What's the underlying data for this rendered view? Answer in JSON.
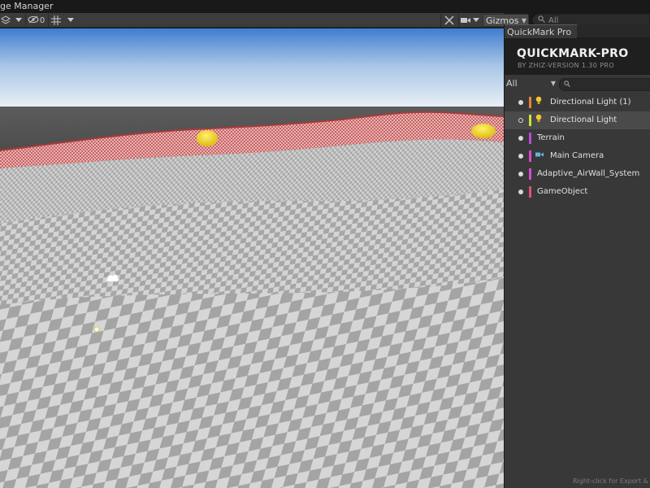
{
  "menu": {
    "title": "ge Manager"
  },
  "scene_toolbar": {
    "layers_icon": "layers-icon",
    "visibility_count": "0",
    "grid_icon": "grid-icon",
    "tools_icon": "tools-icon",
    "camera_icon": "camera-icon",
    "gizmos_label": "Gizmos",
    "search_placeholder": "All"
  },
  "panel": {
    "tab_label": "QuickMark Pro",
    "brand": "QUICKMARK-PRO",
    "version": "BY ZHIZ-VERSION 1.30 PRO",
    "filter_value": "All",
    "items": [
      {
        "label": "Directional Light (1)",
        "color": "#e8823a",
        "icon": "light-bulb-icon",
        "selected": false,
        "hollow": false
      },
      {
        "label": "Directional Light",
        "color": "#cde23a",
        "icon": "light-bulb-icon",
        "selected": true,
        "hollow": true
      },
      {
        "label": "Terrain",
        "color": "#b84ad8",
        "icon": "",
        "selected": false,
        "hollow": false
      },
      {
        "label": "Main Camera",
        "color": "#d84ad0",
        "icon": "camera-icon",
        "selected": false,
        "hollow": false
      },
      {
        "label": "Adaptive_AirWall_System",
        "color": "#d84ad0",
        "icon": "",
        "selected": false,
        "hollow": false
      },
      {
        "label": "GameObject",
        "color": "#e0507a",
        "icon": "",
        "selected": false,
        "hollow": false
      }
    ],
    "footer_hint": "Right-click for Export &"
  },
  "colors": {
    "sky_top": "#3f7dd0",
    "horizon": "#e6edf4",
    "ground_far": "#4a4a4a",
    "wall_red": "#b94a4a",
    "sphere": "#e8d21c"
  }
}
